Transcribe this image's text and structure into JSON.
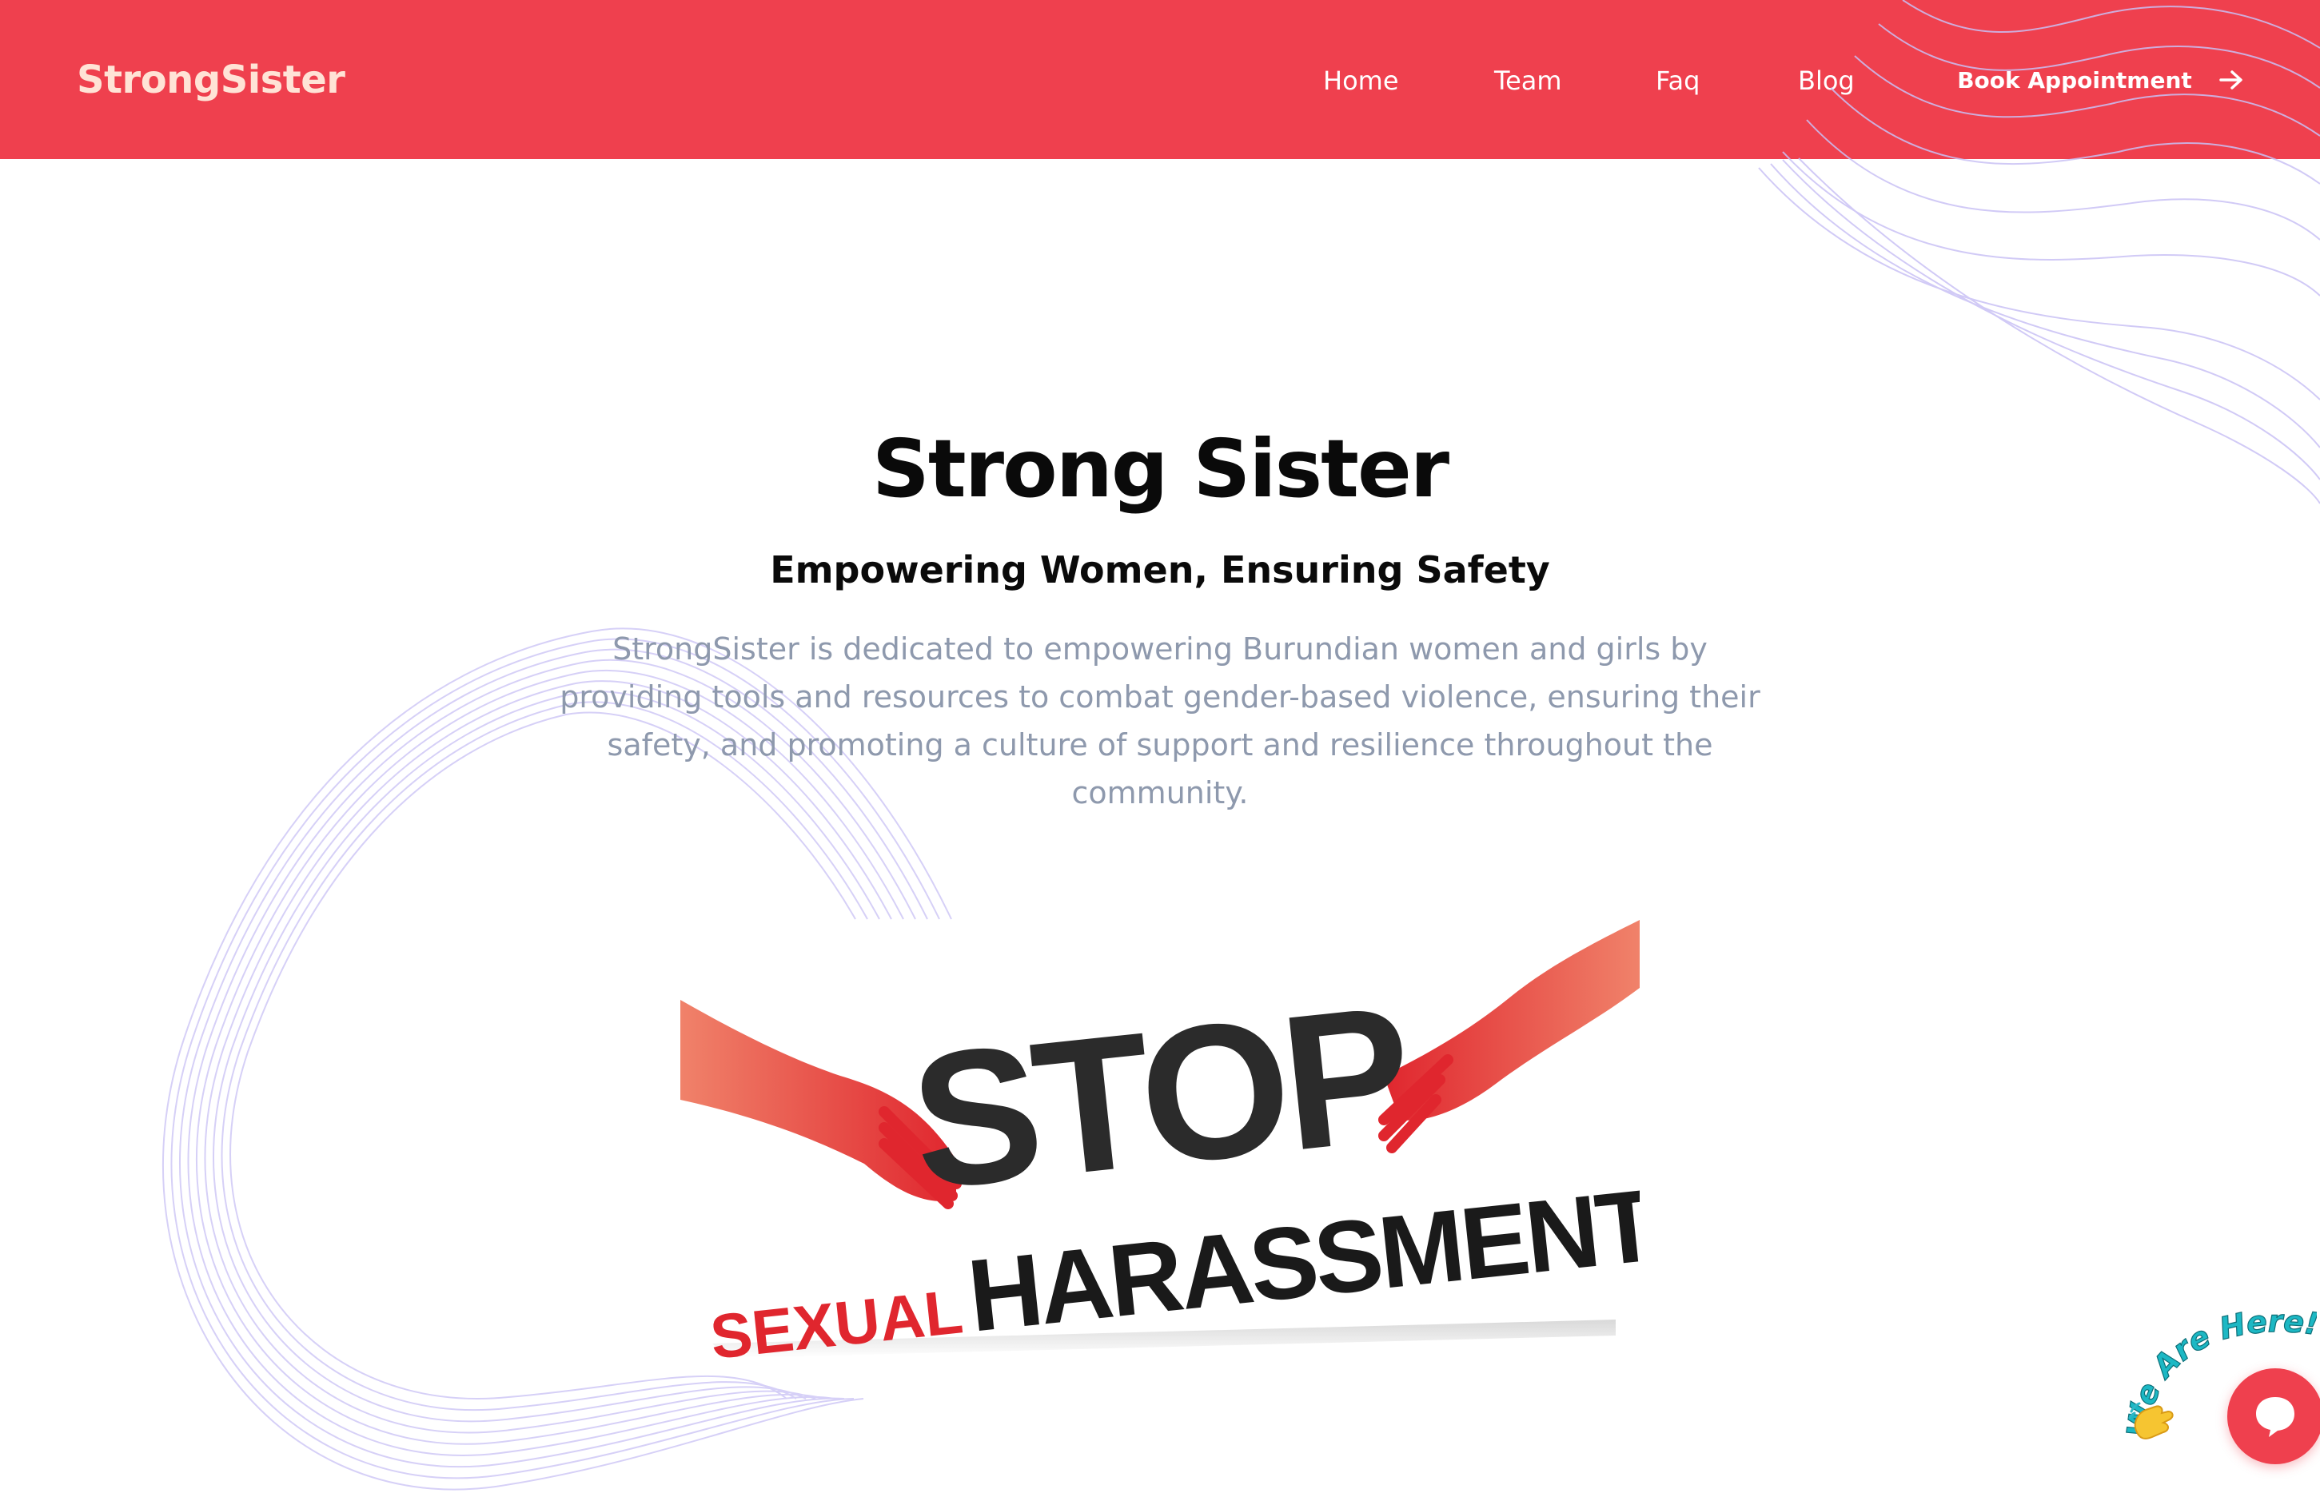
{
  "header": {
    "logo": "StrongSister",
    "nav": {
      "home": "Home",
      "team": "Team",
      "faq": "Faq",
      "blog": "Blog"
    },
    "cta_label": "Book Appointment",
    "cta_icon": "arrow-right-icon",
    "background_color": "#ef404e"
  },
  "hero": {
    "title": "Strong Sister",
    "subtitle": "Empowering Women, Ensuring Safety",
    "description": "StrongSister is dedicated to empowering Burundian women and girls by providing tools and resources to combat gender-based violence, ensuring their safety, and promoting a culture of support and resilience throughout the community.",
    "image": {
      "word_stop": "STOP",
      "word_sexual": "SEXUAL",
      "word_harassment": "HARASSMENT"
    }
  },
  "chat_widget": {
    "badge_text": "We Are Here!",
    "hand_icon": "waving-hand-icon",
    "button_icon": "chat-bubble-icon",
    "accent_color": "#ef404e"
  },
  "colors": {
    "brand": "#ef404e",
    "logo_text": "#ffe3d6",
    "muted_text": "#8e99ad",
    "wave_lines": "#cfc8f5"
  }
}
